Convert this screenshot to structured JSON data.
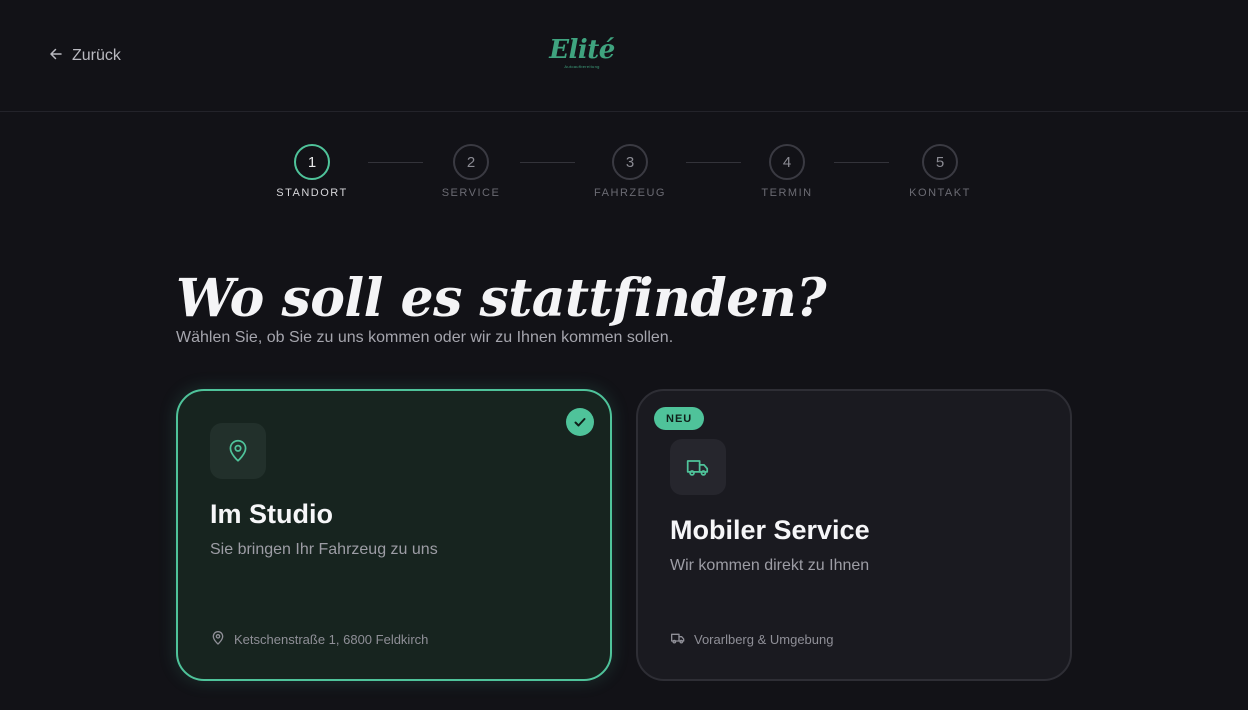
{
  "header": {
    "back_label": "Zurück",
    "logo_text": "Elité",
    "logo_subtext": "Autoaufbereitung"
  },
  "stepper": {
    "steps": [
      {
        "number": "1",
        "label": "STANDORT",
        "active": true
      },
      {
        "number": "2",
        "label": "SERVICE",
        "active": false
      },
      {
        "number": "3",
        "label": "FAHRZEUG",
        "active": false
      },
      {
        "number": "4",
        "label": "TERMIN",
        "active": false
      },
      {
        "number": "5",
        "label": "KONTAKT",
        "active": false
      }
    ]
  },
  "main": {
    "title": "Wo soll es stattfinden?",
    "subtitle": "Wählen Sie, ob Sie zu uns kommen oder wir zu Ihnen kommen sollen."
  },
  "options": [
    {
      "title": "Im Studio",
      "description": "Sie bringen Ihr Fahrzeug zu uns",
      "footer": "Ketschenstraße 1, 6800 Feldkirch",
      "icon": "map-pin-icon",
      "selected": true
    },
    {
      "badge": "NEU",
      "title": "Mobiler Service",
      "description": "Wir kommen direkt zu Ihnen",
      "footer": "Vorarlberg & Umgebung",
      "icon": "truck-icon",
      "selected": false
    }
  ],
  "colors": {
    "accent": "#4fc39a",
    "background": "#121217",
    "card": "#1a1a20"
  }
}
